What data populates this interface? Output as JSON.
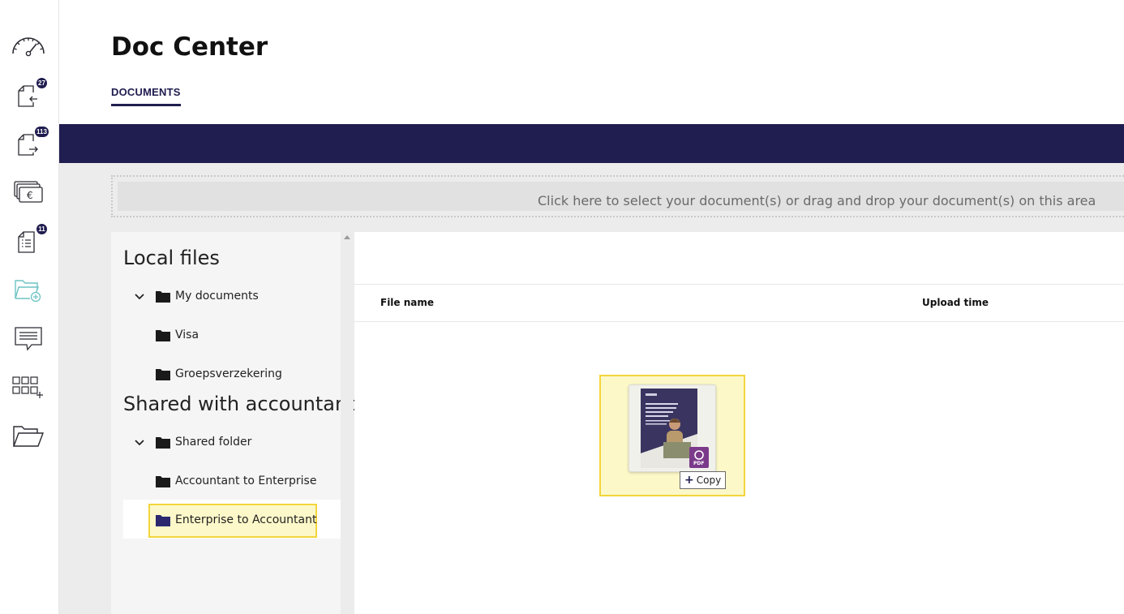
{
  "page": {
    "title": "Doc Center"
  },
  "tabs": [
    {
      "label": "DOCUMENTS",
      "active": true
    }
  ],
  "sidebar": {
    "items": [
      {
        "icon": "dashboard-gauge-icon"
      },
      {
        "icon": "incoming-documents-icon",
        "badge": "27"
      },
      {
        "icon": "outgoing-documents-icon",
        "badge": "113"
      },
      {
        "icon": "euro-payments-icon"
      },
      {
        "icon": "checklist-document-icon",
        "badge": "11"
      },
      {
        "icon": "add-folder-icon"
      },
      {
        "icon": "messages-icon"
      },
      {
        "icon": "add-apps-icon"
      },
      {
        "icon": "open-folder-icon"
      }
    ]
  },
  "dropzone": {
    "text": "Click here to select your document(s) or drag and drop your document(s) on this area"
  },
  "tree": {
    "sections": [
      {
        "title": "Local files",
        "root": {
          "label": "My documents",
          "expanded": true,
          "children": [
            {
              "label": "Visa"
            },
            {
              "label": "Groepsverzekering"
            }
          ]
        }
      },
      {
        "title": "Shared with accountant",
        "root": {
          "label": "Shared folder",
          "expanded": true,
          "children": [
            {
              "label": "Accountant to Enterprise"
            },
            {
              "label": "Enterprise to Accountant",
              "selected": true
            }
          ]
        }
      }
    ]
  },
  "file_list": {
    "columns": {
      "file_name": "File name",
      "upload_time": "Upload time"
    },
    "rows": []
  },
  "drag_ghost": {
    "file_type": "PDF",
    "action_label": "Copy",
    "thumbnail": "pdf-thumbnail-icon"
  },
  "colors": {
    "brand_navy": "#201e50",
    "drag_highlight_fill": "#fdf8c9",
    "drag_highlight_border": "#f2d53c",
    "pdf_badge": "#7b3a8a"
  }
}
